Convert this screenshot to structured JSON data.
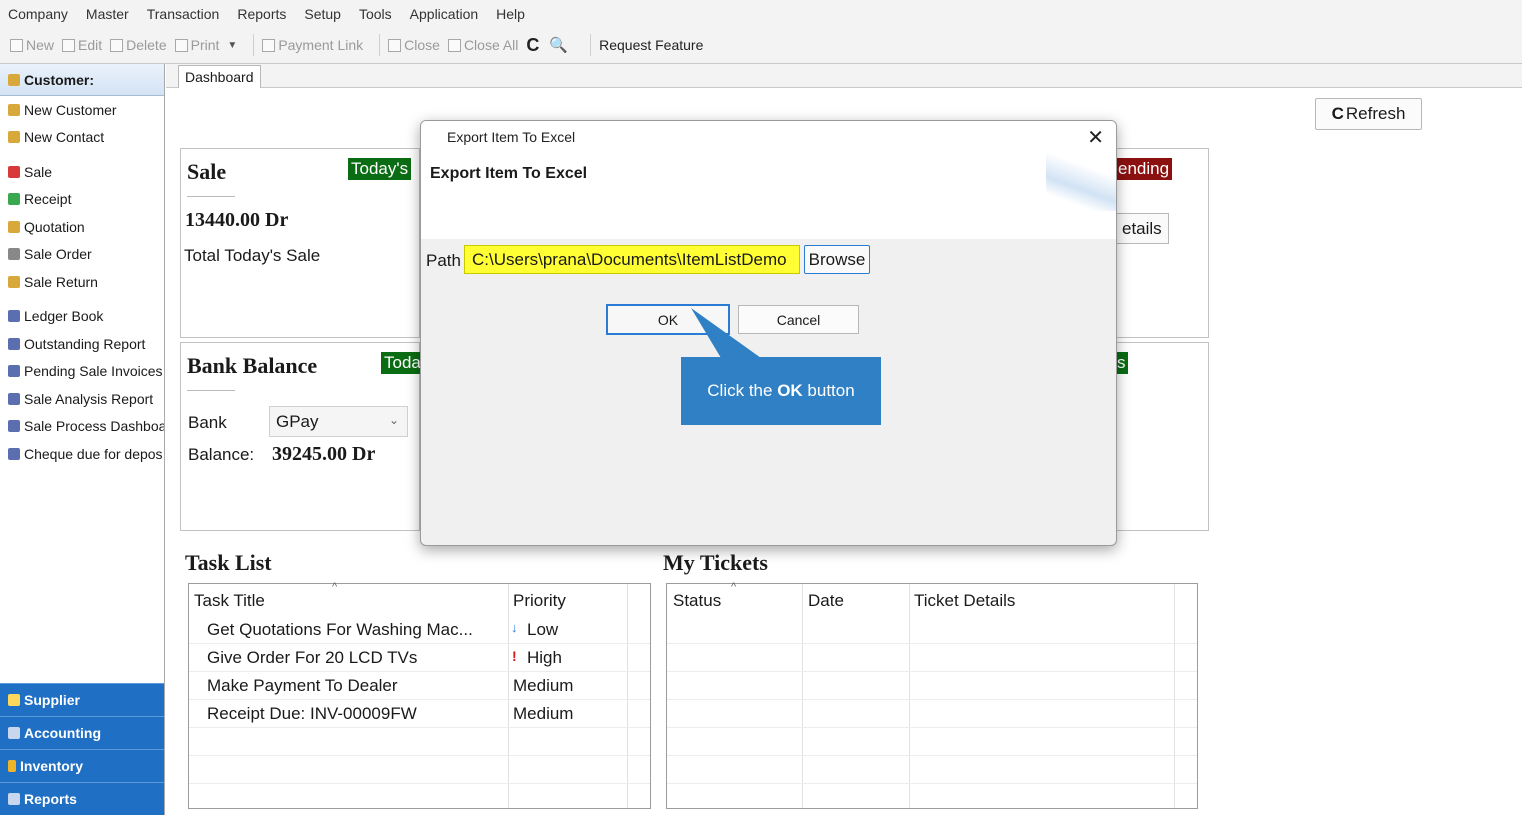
{
  "menu": [
    "Company",
    "Master",
    "Transaction",
    "Reports",
    "Setup",
    "Tools",
    "Application",
    "Help"
  ],
  "toolbar": {
    "new": "New",
    "edit": "Edit",
    "delete": "Delete",
    "print": "Print",
    "dropdown": "▼",
    "payment_link": "Payment Link",
    "close": "Close",
    "close_all": "Close All",
    "refresh_glyph": "C",
    "search_glyph": "🔍",
    "request_feature": "Request Feature"
  },
  "sidebar": {
    "header": "Customer:",
    "items": [
      {
        "label": "New Customer",
        "icon": "user-icon",
        "color": "#d8a93a"
      },
      {
        "label": "New Contact",
        "icon": "user-icon",
        "color": "#d8a93a"
      },
      {
        "label": "Sale",
        "icon": "sale-icon",
        "color": "#d83a3a"
      },
      {
        "label": "Receipt",
        "icon": "receipt-icon",
        "color": "#3aa84f"
      },
      {
        "label": "Quotation",
        "icon": "user-icon",
        "color": "#d8a93a"
      },
      {
        "label": "Sale Order",
        "icon": "order-icon",
        "color": "#888888"
      },
      {
        "label": "Sale Return",
        "icon": "user-icon",
        "color": "#d8a93a"
      },
      {
        "label": "Ledger Book",
        "icon": "report-icon",
        "color": "#5b6fb0"
      },
      {
        "label": "Outstanding Report",
        "icon": "report-icon",
        "color": "#5b6fb0"
      },
      {
        "label": "Pending Sale Invoices",
        "icon": "report-icon",
        "color": "#5b6fb0"
      },
      {
        "label": "Sale Analysis Report",
        "icon": "report-icon",
        "color": "#5b6fb0"
      },
      {
        "label": "Sale Process Dashboa",
        "icon": "report-icon",
        "color": "#5b6fb0"
      },
      {
        "label": "Cheque due for depos",
        "icon": "report-icon",
        "color": "#5b6fb0"
      }
    ],
    "bottom": [
      "Supplier",
      "Accounting",
      "Inventory",
      "Reports"
    ]
  },
  "tabs": {
    "dashboard": "Dashboard"
  },
  "dashboard": {
    "refresh_label": "Refresh",
    "sale": {
      "title": "Sale",
      "badge": "Today's",
      "amount": "13440.00 Dr",
      "caption": "Total Today's Sale"
    },
    "pending_badge": "ending",
    "details_btn": "etails",
    "bank": {
      "title": "Bank Balance",
      "badge": "Toda",
      "bank_label": "Bank",
      "bank_value": "GPay",
      "balance_label": "Balance:",
      "balance_value": "39245.00 Dr"
    },
    "small_badge": "s",
    "task_list": {
      "title": "Task List",
      "columns": [
        "Task Title",
        "Priority"
      ],
      "rows": [
        {
          "title": "Get Quotations For Washing Mac...",
          "priority": "Low",
          "marker": "↓"
        },
        {
          "title": "Give Order For 20 LCD TVs",
          "priority": "High",
          "marker": "!"
        },
        {
          "title": "Make Payment To Dealer",
          "priority": "Medium",
          "marker": ""
        },
        {
          "title": "Receipt Due: INV-00009FW",
          "priority": "Medium",
          "marker": ""
        }
      ]
    },
    "tickets": {
      "title": "My Tickets",
      "columns": [
        "Status",
        "Date",
        "Ticket Details"
      ]
    }
  },
  "dialog": {
    "window_title": "Export Item To Excel",
    "heading": "Export Item To Excel",
    "close_glyph": "✕",
    "path_label": "Path",
    "path_value": "C:\\Users\\prana\\Documents\\ItemListDemo",
    "browse_label": "Browse",
    "ok_label": "OK",
    "cancel_label": "Cancel"
  },
  "callout": {
    "prefix": "Click the ",
    "bold": "OK",
    "suffix": " button"
  },
  "colors": {
    "accent": "#2a7bd4",
    "callout": "#2f80c5",
    "highlight": "#ffff33",
    "green_badge": "#0b6d13",
    "red_badge": "#8b1010",
    "sidebar_bottom": "#1f6fc4"
  }
}
